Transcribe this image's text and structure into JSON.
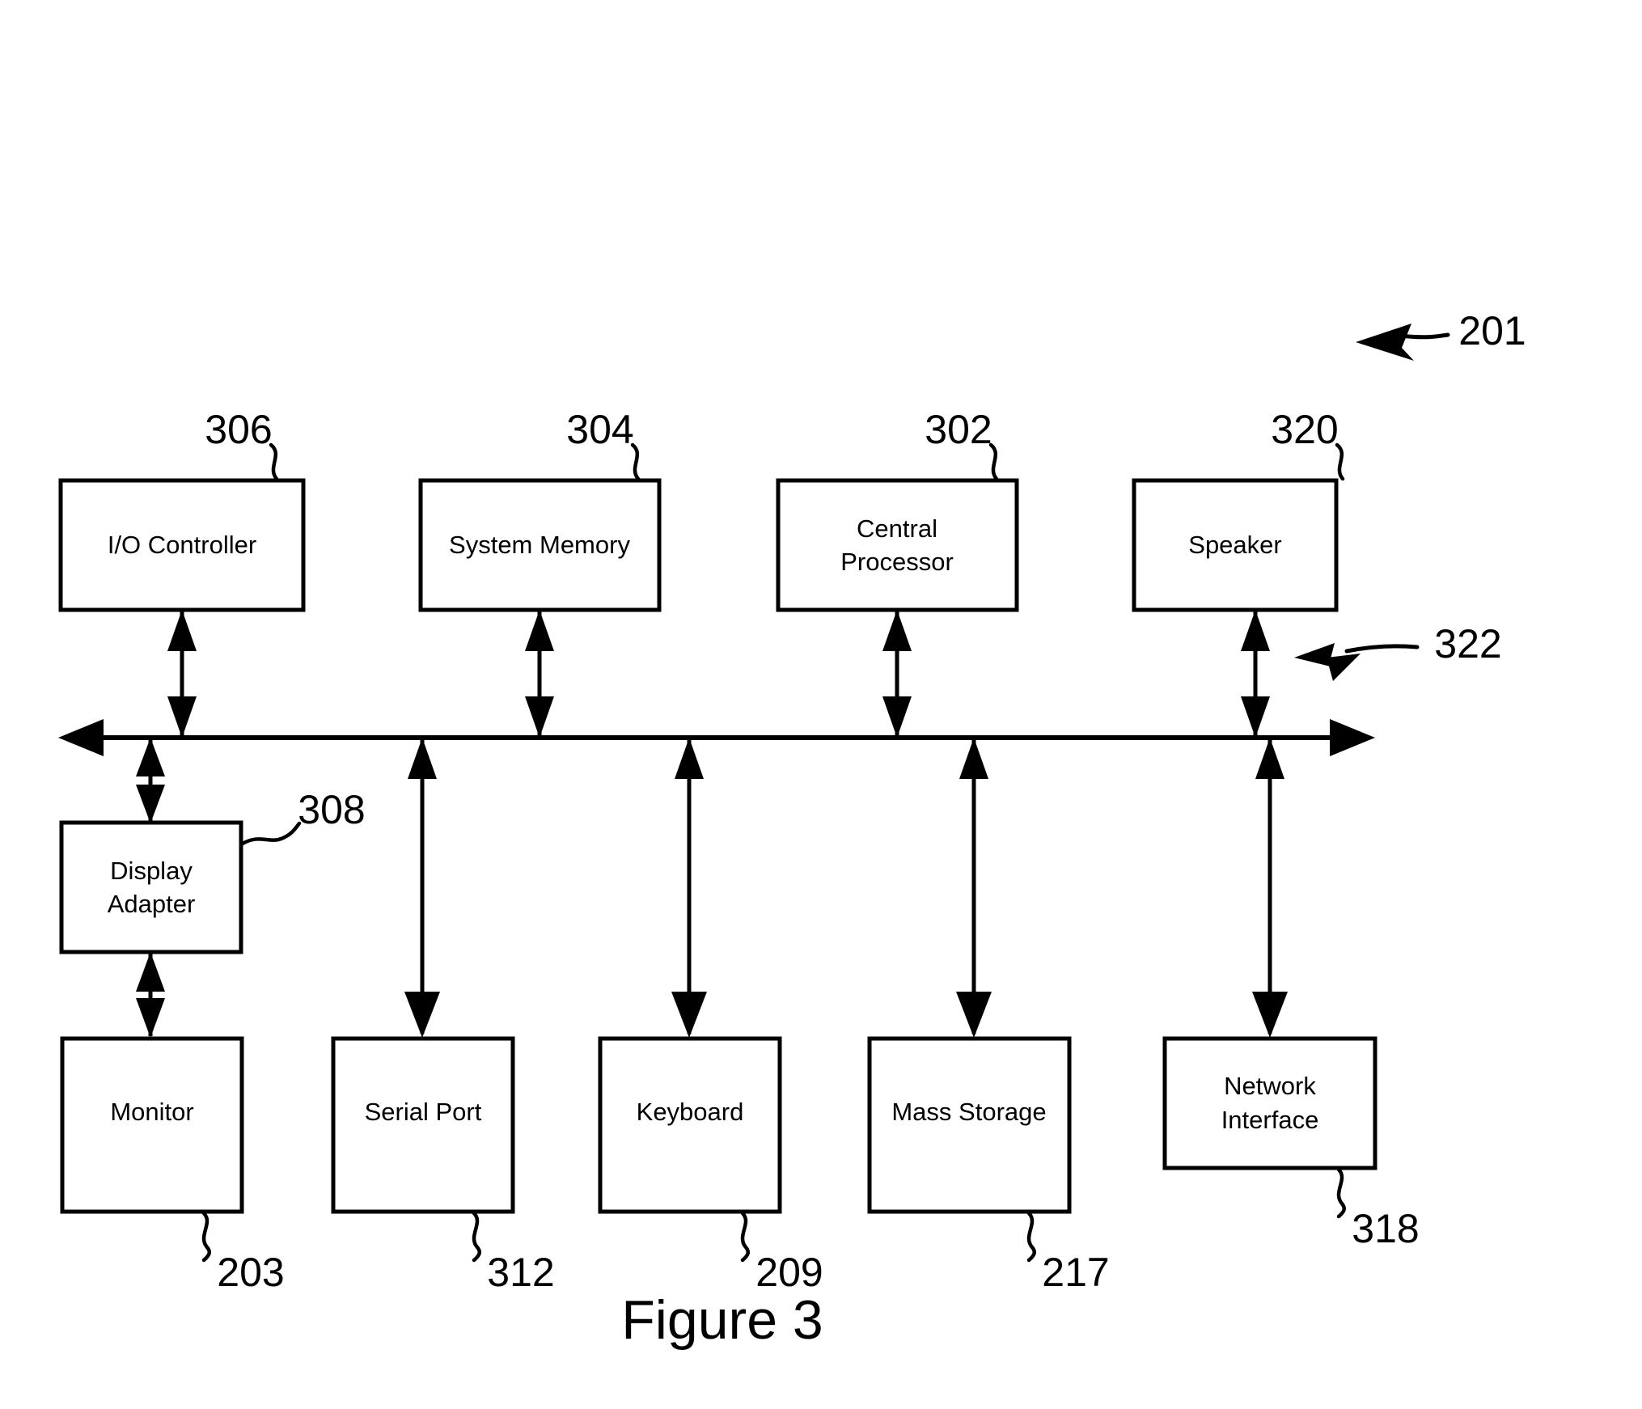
{
  "figure": {
    "caption": "Figure 3",
    "system_ref": "201",
    "bus_ref": "322"
  },
  "top_row": [
    {
      "label": "I/O Controller",
      "label_lines": [
        "I/O Controller"
      ],
      "ref": "306"
    },
    {
      "label": "System Memory",
      "label_lines": [
        "System Memory"
      ],
      "ref": "304"
    },
    {
      "label": "Central Processor",
      "label_lines": [
        "Central",
        "Processor"
      ],
      "ref": "302"
    },
    {
      "label": "Speaker",
      "label_lines": [
        "Speaker"
      ],
      "ref": "320"
    }
  ],
  "middle_row": [
    {
      "label": "Display Adapter",
      "label_lines": [
        "Display",
        "Adapter"
      ],
      "ref": "308"
    }
  ],
  "bottom_row": [
    {
      "label": "Monitor",
      "label_lines": [
        "Monitor"
      ],
      "ref": "203"
    },
    {
      "label": "Serial Port",
      "label_lines": [
        "Serial Port"
      ],
      "ref": "312"
    },
    {
      "label": "Keyboard",
      "label_lines": [
        "Keyboard"
      ],
      "ref": "209"
    },
    {
      "label": "Mass Storage",
      "label_lines": [
        "Mass Storage"
      ],
      "ref": "217"
    },
    {
      "label": "Network Interface",
      "label_lines": [
        "Network",
        "Interface"
      ],
      "ref": "318"
    }
  ],
  "colors": {
    "stroke": "#000000",
    "fill": "#ffffff",
    "background": "#ffffff"
  }
}
